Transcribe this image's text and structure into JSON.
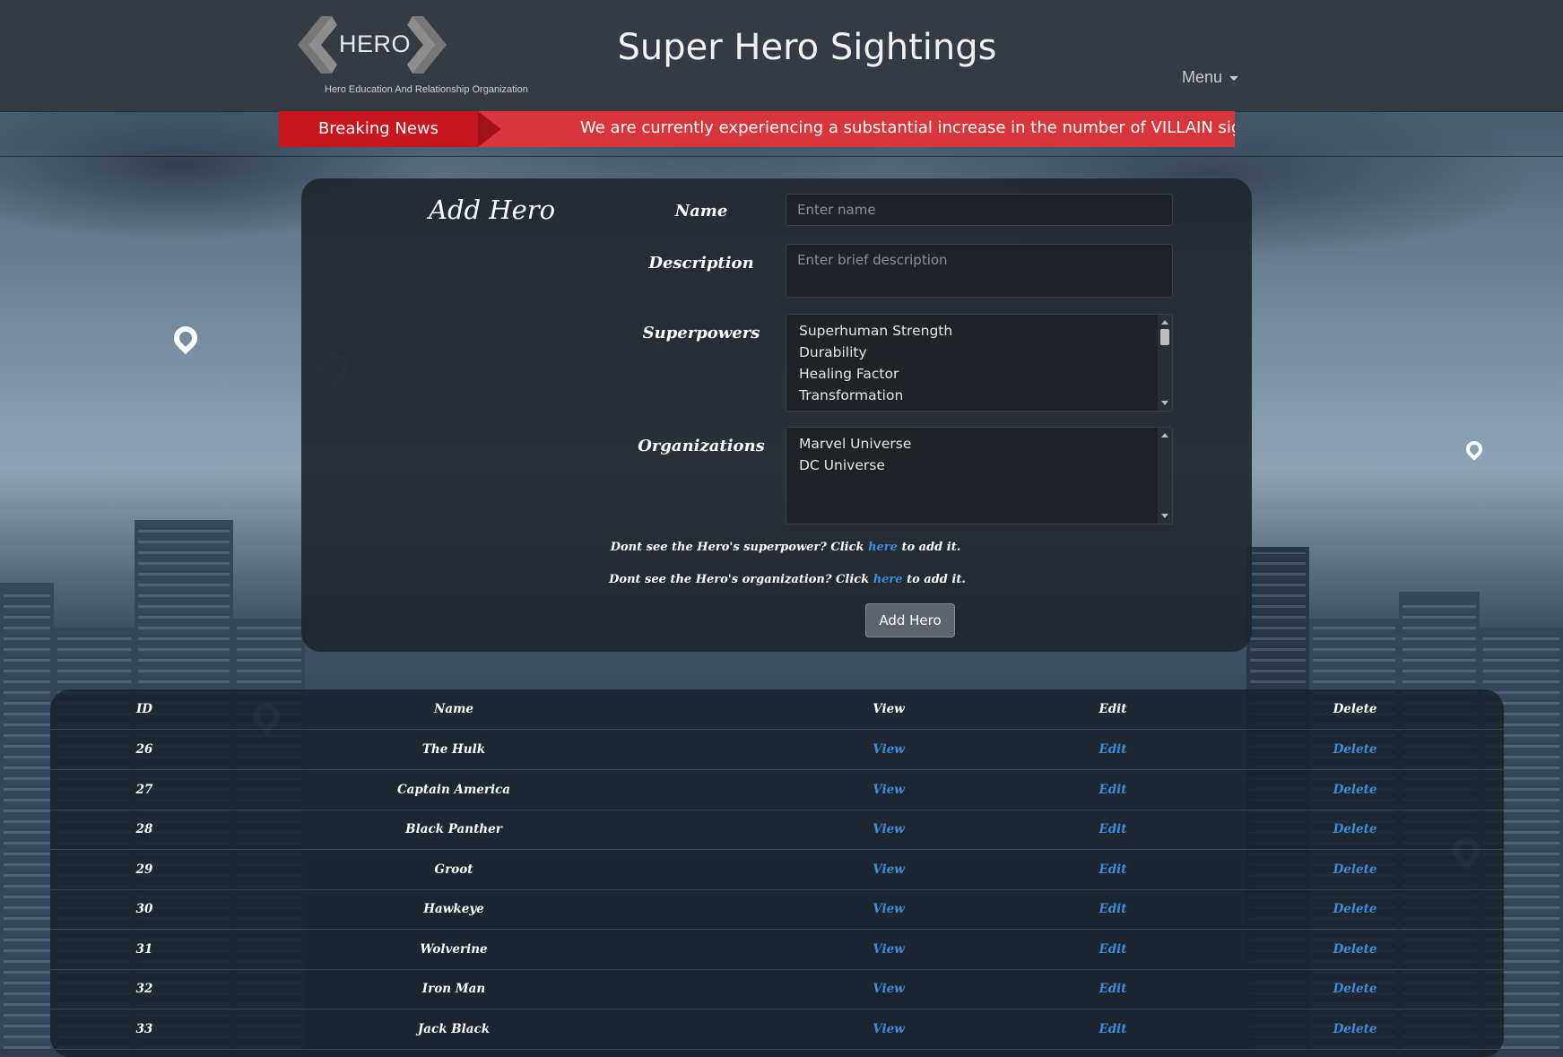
{
  "header": {
    "logo_word": "HERO",
    "logo_tagline": "Hero Education And Relationship Organization",
    "site_title": "Super Hero Sightings",
    "menu_label": "Menu"
  },
  "news": {
    "label": "Breaking News",
    "ticker": "We are currently experiencing a substantial increase in the number of VILLAIN sigl"
  },
  "form": {
    "title": "Add Hero",
    "name_label": "Name",
    "name_placeholder": "Enter name",
    "description_label": "Description",
    "description_placeholder": "Enter brief description",
    "superpowers_label": "Superpowers",
    "superpowers": [
      "Superhuman Strength",
      "Durability",
      "Healing Factor",
      "Transformation"
    ],
    "organizations_label": "Organizations",
    "organizations": [
      "Marvel Universe",
      "DC Universe"
    ],
    "hint_power_pre": "Dont see the Hero's superpower? Click ",
    "hint_power_link": "here",
    "hint_power_post": " to add it.",
    "hint_org_pre": "Dont see the Hero's organization? Click ",
    "hint_org_link": "here",
    "hint_org_post": " to add it.",
    "submit_label": "Add Hero"
  },
  "table": {
    "headers": {
      "id": "ID",
      "name": "Name",
      "view": "View",
      "edit": "Edit",
      "delete": "Delete"
    },
    "rows": [
      {
        "id": "26",
        "name": "The Hulk",
        "view": "View",
        "edit": "Edit",
        "delete": "Delete"
      },
      {
        "id": "27",
        "name": "Captain America",
        "view": "View",
        "edit": "Edit",
        "delete": "Delete"
      },
      {
        "id": "28",
        "name": "Black Panther",
        "view": "View",
        "edit": "Edit",
        "delete": "Delete"
      },
      {
        "id": "29",
        "name": "Groot",
        "view": "View",
        "edit": "Edit",
        "delete": "Delete"
      },
      {
        "id": "30",
        "name": "Hawkeye",
        "view": "View",
        "edit": "Edit",
        "delete": "Delete"
      },
      {
        "id": "31",
        "name": "Wolverine",
        "view": "View",
        "edit": "Edit",
        "delete": "Delete"
      },
      {
        "id": "32",
        "name": "Iron Man",
        "view": "View",
        "edit": "Edit",
        "delete": "Delete"
      },
      {
        "id": "33",
        "name": "Jack Black",
        "view": "View",
        "edit": "Edit",
        "delete": "Delete"
      }
    ]
  },
  "colors": {
    "header_bg": "#353b44",
    "news_red": "#c9161c",
    "ticker_red": "#d9363c",
    "link_blue": "#3c8dde",
    "panel_bg": "#21262c"
  },
  "icons": {
    "logo_chevrons": "chevron-left-right-icon",
    "menu_caret": "caret-down-icon",
    "map_pin": "map-pin-icon"
  }
}
